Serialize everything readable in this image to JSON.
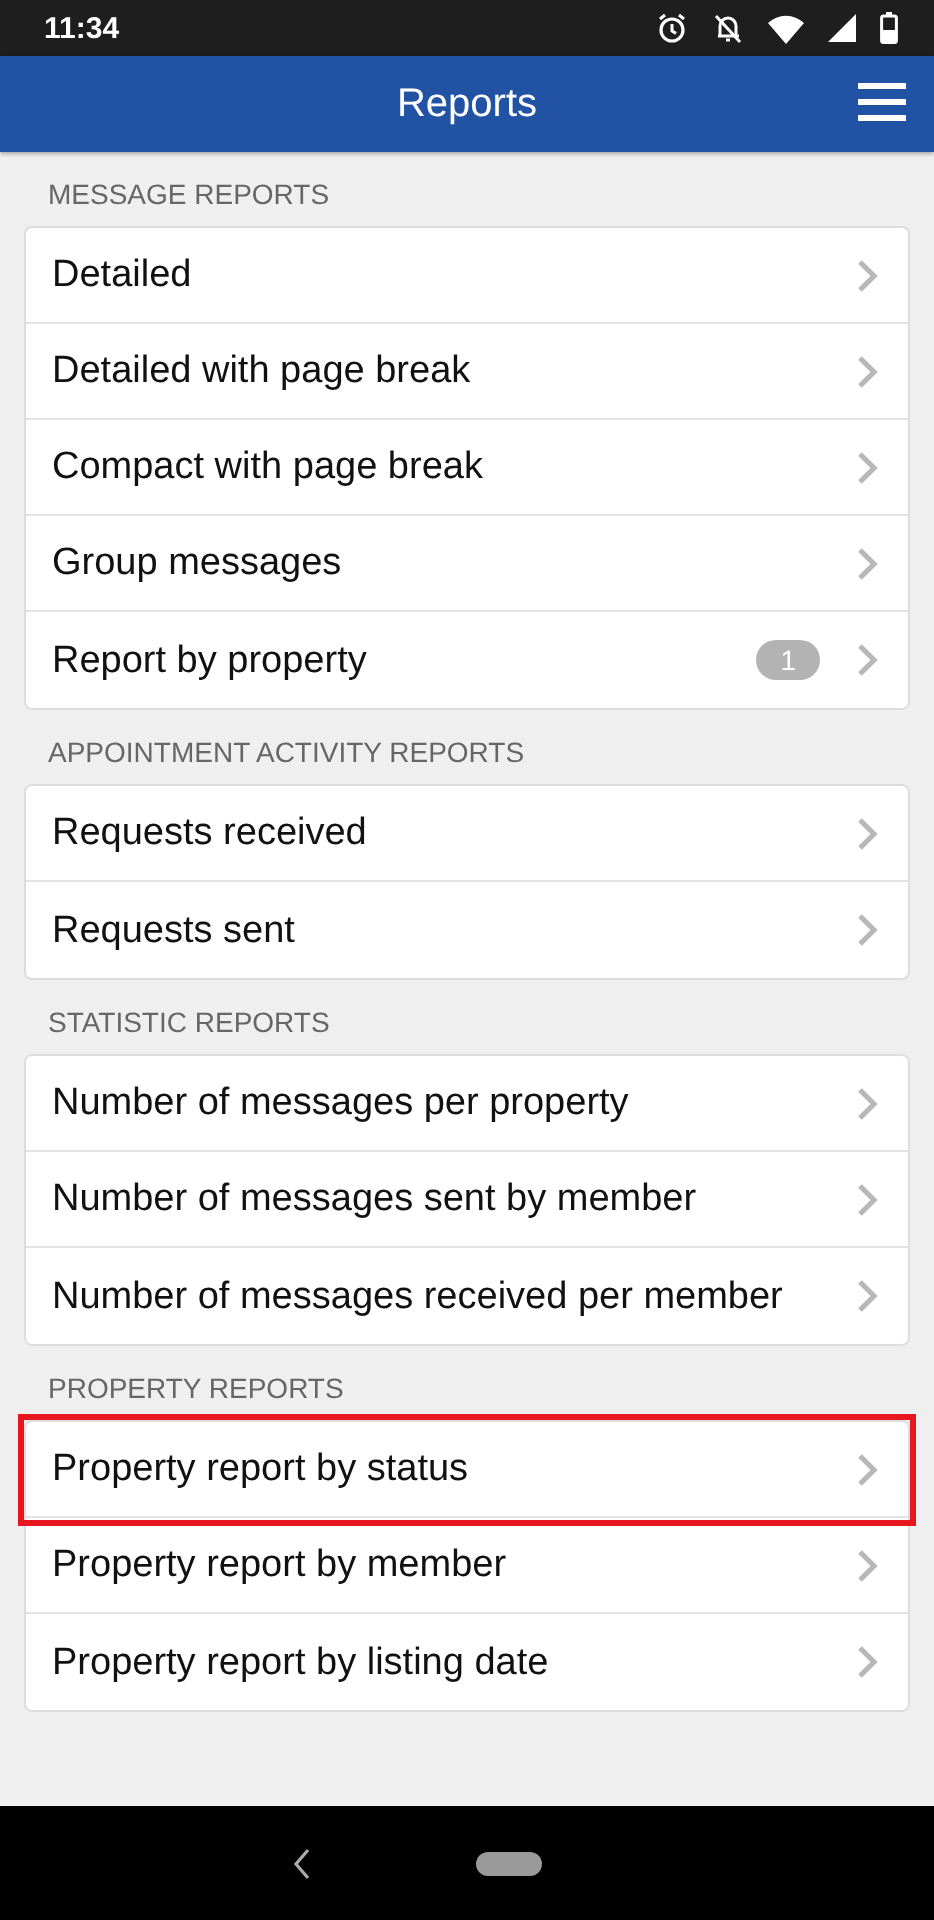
{
  "status_bar": {
    "time": "11:34"
  },
  "header": {
    "title": "Reports"
  },
  "sections": [
    {
      "title": "MESSAGE REPORTS",
      "items": [
        {
          "label": "Detailed",
          "selected": false
        },
        {
          "label": "Detailed with page break",
          "selected": false
        },
        {
          "label": "Compact with page break",
          "selected": false
        },
        {
          "label": "Group messages",
          "selected": false
        },
        {
          "label": "Report by property",
          "badge": "1",
          "selected": false
        }
      ]
    },
    {
      "title": "APPOINTMENT ACTIVITY REPORTS",
      "items": [
        {
          "label": "Requests received",
          "selected": false
        },
        {
          "label": "Requests sent",
          "selected": false
        }
      ]
    },
    {
      "title": "STATISTIC REPORTS",
      "items": [
        {
          "label": "Number of messages per property",
          "selected": false
        },
        {
          "label": "Number of messages sent by member",
          "selected": false
        },
        {
          "label": "Number of messages received per member",
          "selected": false
        }
      ]
    },
    {
      "title": "PROPERTY REPORTS",
      "items": [
        {
          "label": "Property report by status",
          "selected": true
        },
        {
          "label": "Property report by member",
          "selected": false
        },
        {
          "label": "Property report by listing date",
          "selected": false
        }
      ]
    }
  ]
}
